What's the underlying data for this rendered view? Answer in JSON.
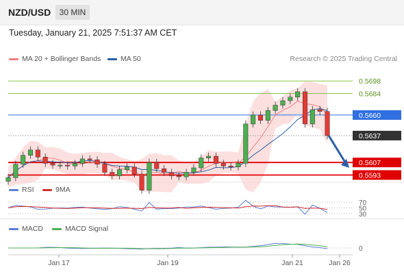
{
  "header": {
    "symbol": "NZD/USD",
    "timeframe": "30 MIN"
  },
  "timestamp": "Tuesday, January 21, 2025 7:51:37 AM CET",
  "legend": {
    "ma20": "MA 20 + Bollinger Bands",
    "ma50": "MA 50",
    "rsi": "RSI",
    "rsi_ma": "9MA",
    "macd": "MACD",
    "macd_signal": "MACD Signal"
  },
  "credit": "Research © 2025 Trading Central",
  "colors": {
    "up": "#4caf50",
    "down": "#e53935",
    "ma20": "#f08080",
    "ma50": "#2a5fa6",
    "band": "#fbd5d5",
    "green_level": "#8bc34a",
    "blue_level": "#2f6fe0",
    "red_level": "#e00000",
    "current": "#333333",
    "rsi": "#5b7fd6",
    "rsi_ma": "#d32f2f",
    "macd": "#5b7fd6",
    "macd_signal": "#4caf50"
  },
  "chart_data": {
    "type": "candlestick",
    "x_ticks": [
      "Jan 17",
      "Jan 19",
      "Jan 21",
      "Jan 26"
    ],
    "y_range": [
      0.5588,
      0.5715
    ],
    "levels": [
      {
        "value": "0.5698",
        "type": "resistance-green"
      },
      {
        "value": "0.5684",
        "type": "resistance-green"
      },
      {
        "value": "0.5660",
        "type": "pivot-blue"
      },
      {
        "value": "0.5637",
        "type": "current"
      },
      {
        "value": "0.5607",
        "type": "support-red"
      },
      {
        "value": "0.5593",
        "type": "support-red"
      }
    ],
    "forecast": {
      "from": 0.5637,
      "to": 0.5601,
      "direction": "down"
    },
    "close": [
      0.559,
      0.5605,
      0.5615,
      0.5621,
      0.5613,
      0.5606,
      0.5604,
      0.5604,
      0.5603,
      0.5606,
      0.5611,
      0.561,
      0.5605,
      0.5596,
      0.5592,
      0.5599,
      0.5602,
      0.5594,
      0.5576,
      0.5607,
      0.56,
      0.5596,
      0.5592,
      0.5591,
      0.5596,
      0.5601,
      0.5612,
      0.5614,
      0.5606,
      0.5603,
      0.5602,
      0.5606,
      0.565,
      0.566,
      0.5654,
      0.5665,
      0.5671,
      0.5676,
      0.568,
      0.5686,
      0.565,
      0.5666,
      0.5664,
      0.5637
    ],
    "sub_panels": [
      {
        "name": "RSI",
        "ticks": [
          "70",
          "50",
          "30"
        ]
      },
      {
        "name": "MACD",
        "ticks": [
          "0"
        ]
      }
    ]
  }
}
